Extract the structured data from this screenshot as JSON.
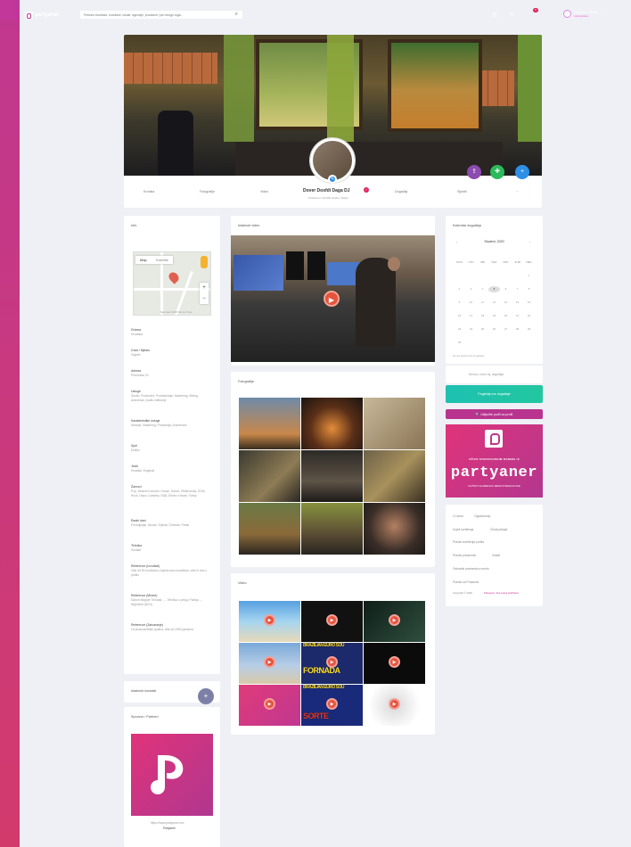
{
  "topbar": {
    "logo_text": "partyaner",
    "search_placeholder": "Pretraži muzičare, izvođače, lokale, agencije, prodavce i još mnogo toga...",
    "notification_count": "6",
    "user_name": "Partyaner Official",
    "user_sub": "Administrator"
  },
  "profile": {
    "name": "Dover Dosfdi Daga DJ",
    "subtitle": "Producent, Muzički Studio, Media",
    "badge": "✓",
    "nav": [
      "Kronika",
      "Fotografije",
      "Video",
      "Događaji",
      "Sljedbi",
      "···"
    ]
  },
  "info": {
    "title": "Info",
    "map_tab_map": "Map",
    "map_tab_sat": "Satellite",
    "map_credit": "Map data ©2020  Terms of Use",
    "fields": [
      {
        "label": "Država",
        "value": "Hrvatska"
      },
      {
        "label": "Grad / Mjesto",
        "value": "Zagreb"
      },
      {
        "label": "Adresa",
        "value": "Primorska 15"
      },
      {
        "label": "Usluge",
        "value": "Studio, Producent, Podučavanje, Mastering, Mixing, Aranžman, Audio editiranje"
      },
      {
        "label": "Karakteristike usluge",
        "value": "Mixanje, Mastering, Produkcija, Aranžmani"
      },
      {
        "label": "Spol",
        "value": "Muško"
      },
      {
        "label": "Jezik",
        "value": "Hrvatski, Engleski"
      },
      {
        "label": "Žanrovi",
        "value": "Pop, Moderni narodni, House, Dance, Elektronska, EDM, Rock, Disco, Dubstep, R&B, Electro House, Funky"
      },
      {
        "label": "Radni dani",
        "value": "Ponedjeljak, Utorak, Srijeda, Četvrtak, Petak"
      },
      {
        "label": "Tehnika",
        "value": "Kontakt"
      },
      {
        "label": "Reference (Izvođači)",
        "value": "Više od 50 izvođača s kojima sam surađivao, više ih ima u profilu"
      },
      {
        "label": "Reference (Mixevi)",
        "value": "Dance Mapper Trinidad, ..., Tehnika u prilog: Pažnja ..., Nightclub (BCN)"
      },
      {
        "label": "Reference (Zatvaranje)",
        "value": "15 producentskih godina, više od 2000 pjesama"
      }
    ]
  },
  "contacts": {
    "title": "Istaknuti kontakti",
    "plus": "+"
  },
  "sponsor": {
    "title": "Sponzor / Partneri",
    "link": "https://www.partyaner.com",
    "name": "Partyaner"
  },
  "videos_featured": {
    "title": "Istaknuti video"
  },
  "photos": {
    "title": "Fotografije"
  },
  "videos": {
    "title": "Video",
    "thumb_texts": [
      "FORNADA",
      "BRAZILIAN EURO SOU",
      "SORTE",
      "BRAZILIAN EURO SOU"
    ]
  },
  "calendar": {
    "title": "Kalendar događaja",
    "month": "Studeni, 2020",
    "prev": "‹",
    "next": "›",
    "weekdays": [
      "PON",
      "UTO",
      "SRI",
      "ČET",
      "PET",
      "SUB",
      "NED"
    ],
    "weeks": [
      [
        "",
        "",
        "",
        "",
        "",
        "",
        "1"
      ],
      [
        "2",
        "3",
        "4",
        "5",
        "6",
        "7",
        "8"
      ],
      [
        "9",
        "10",
        "11",
        "12",
        "13",
        "14",
        "15"
      ],
      [
        "16",
        "17",
        "18",
        "19",
        "20",
        "21",
        "22"
      ],
      [
        "23",
        "24",
        "25",
        "26",
        "27",
        "28",
        "29"
      ],
      [
        "30",
        "",
        "",
        "",
        "",
        "",
        ""
      ]
    ],
    "today": "5",
    "footer": "Nema planiranih događaja",
    "no_events": "Nema u ovom mj. događaja"
  },
  "buttons": {
    "events": "Pogledaj sve događaje",
    "promo": "🔍  Uključite profil za profil"
  },
  "ad": {
    "line1": "UŽIVO STARUDIJSKIM DANIMA IZ",
    "brand": "partyaner",
    "line2": "ZA ŽIVOT GLAZBE NAS JEDNA STRANA ZA SVE"
  },
  "links": {
    "row1": [
      "O nama",
      "Oglašavanje"
    ],
    "row2": [
      "Uvjeti korištenja",
      "Česta pitanja"
    ],
    "row3": "Pravila korištenja profila",
    "row4": [
      "Pravila privatnosti",
      "Gradit"
    ],
    "row5": "Ostvarite partnerstvo mreže",
    "row6": "Pravila za Prodavce",
    "copyright": "Copyright © 2020",
    "copyright_link": "Partyaner. Sva prava pridržana."
  }
}
